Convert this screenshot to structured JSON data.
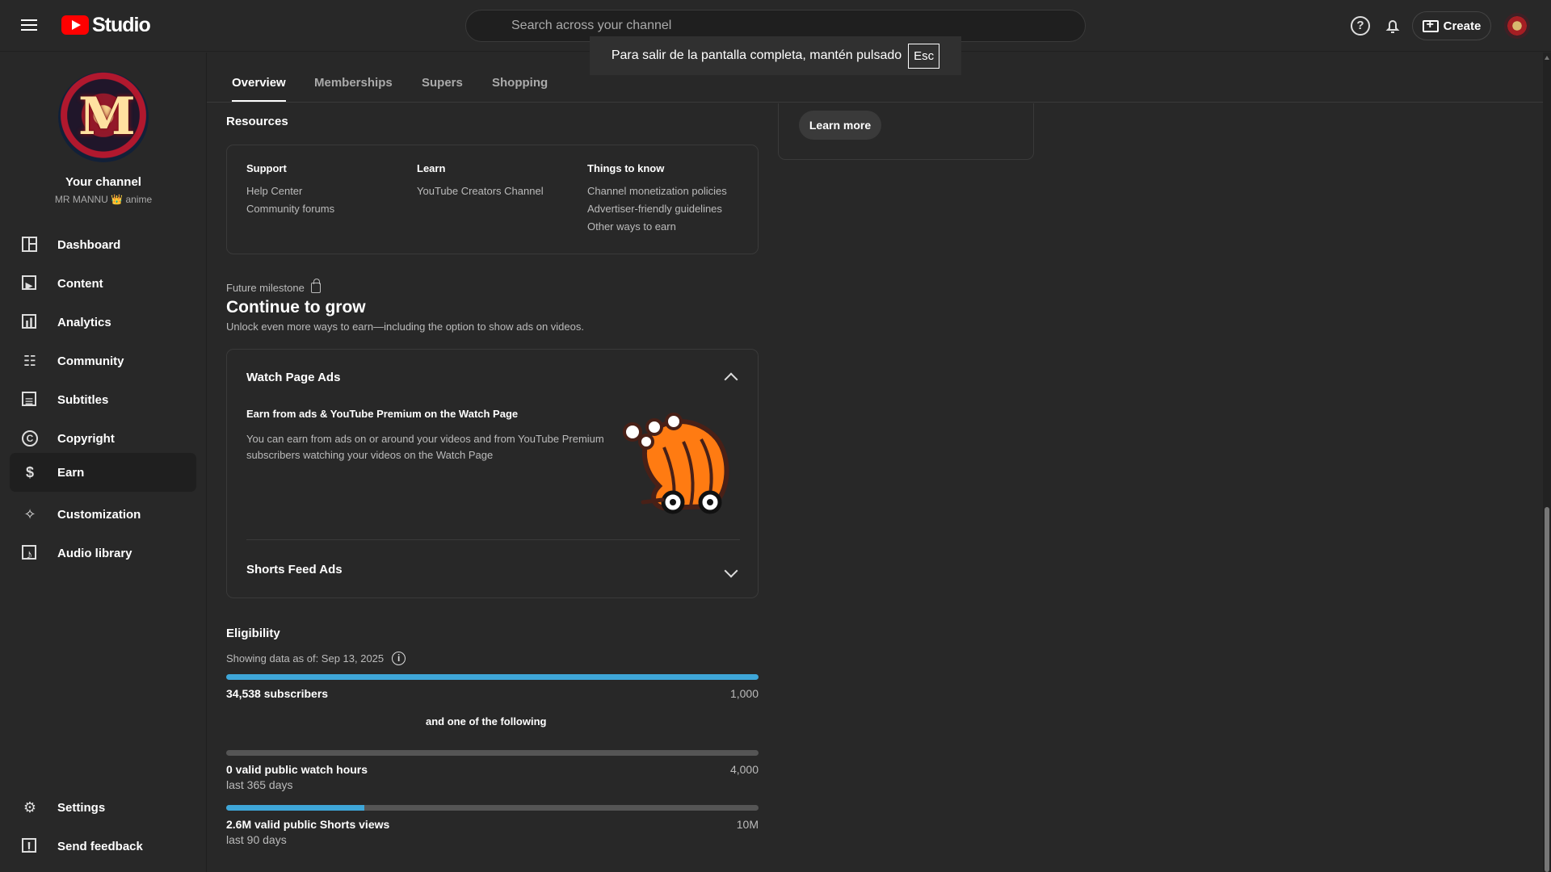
{
  "header": {
    "logo_text": "Studio",
    "search_placeholder": "Search across your channel",
    "create_label": "Create",
    "help_glyph": "?",
    "toast_message": "Para salir de la pantalla completa, mantén pulsado",
    "toast_key": "Esc"
  },
  "sidebar": {
    "channel_title": "Your channel",
    "channel_handle": "MR MANNU 👑 anime",
    "items": [
      {
        "label": "Dashboard",
        "icon": "dashboard-icon"
      },
      {
        "label": "Content",
        "icon": "content-icon"
      },
      {
        "label": "Analytics",
        "icon": "analytics-icon"
      },
      {
        "label": "Community",
        "icon": "community-icon"
      },
      {
        "label": "Subtitles",
        "icon": "subtitles-icon"
      },
      {
        "label": "Copyright",
        "icon": "copyright-icon"
      },
      {
        "label": "Earn",
        "icon": "earn-icon",
        "active": true
      },
      {
        "label": "Customization",
        "icon": "customization-icon"
      },
      {
        "label": "Audio library",
        "icon": "audio-library-icon"
      }
    ],
    "footer_items": [
      {
        "label": "Settings",
        "icon": "settings-icon"
      },
      {
        "label": "Send feedback",
        "icon": "feedback-icon"
      }
    ]
  },
  "tabs": [
    "Overview",
    "Memberships",
    "Supers",
    "Shopping"
  ],
  "resources": {
    "title": "Resources",
    "columns": [
      {
        "title": "Support",
        "links": [
          "Help Center",
          "Community forums"
        ]
      },
      {
        "title": "Learn",
        "links": [
          "YouTube Creators Channel"
        ]
      },
      {
        "title": "Things to know",
        "links": [
          "Channel monetization policies",
          "Advertiser-friendly guidelines",
          "Other ways to earn"
        ]
      }
    ]
  },
  "right_card": {
    "button_label": "Learn more"
  },
  "future": {
    "label": "Future milestone",
    "title": "Continue to grow",
    "subtitle": "Unlock even more ways to earn—including the option to show ads on videos."
  },
  "ads": {
    "watch_title": "Watch Page Ads",
    "watch_heading": "Earn from ads & YouTube Premium on the Watch Page",
    "watch_text": "You can earn from ads on or around your videos and from YouTube Premium subscribers watching your videos on the Watch Page",
    "shorts_title": "Shorts Feed Ads"
  },
  "eligibility": {
    "title": "Eligibility",
    "showing": "Showing data as of: Sep 13, 2025",
    "info_glyph": "i",
    "subscribers": {
      "label": "34,538 subscribers",
      "target": "1,000",
      "progress": 100
    },
    "following": "and one of the following",
    "watch_hours": {
      "label": "0 valid public watch hours",
      "period": "last 365 days",
      "target": "4,000",
      "progress": 0
    },
    "shorts_views": {
      "label": "2.6M valid public Shorts views",
      "period": "last 90 days",
      "target": "10M",
      "progress": 26
    }
  },
  "colors": {
    "background": "#282828",
    "accent": "#3ea6d8",
    "brand": "#ff0000"
  }
}
